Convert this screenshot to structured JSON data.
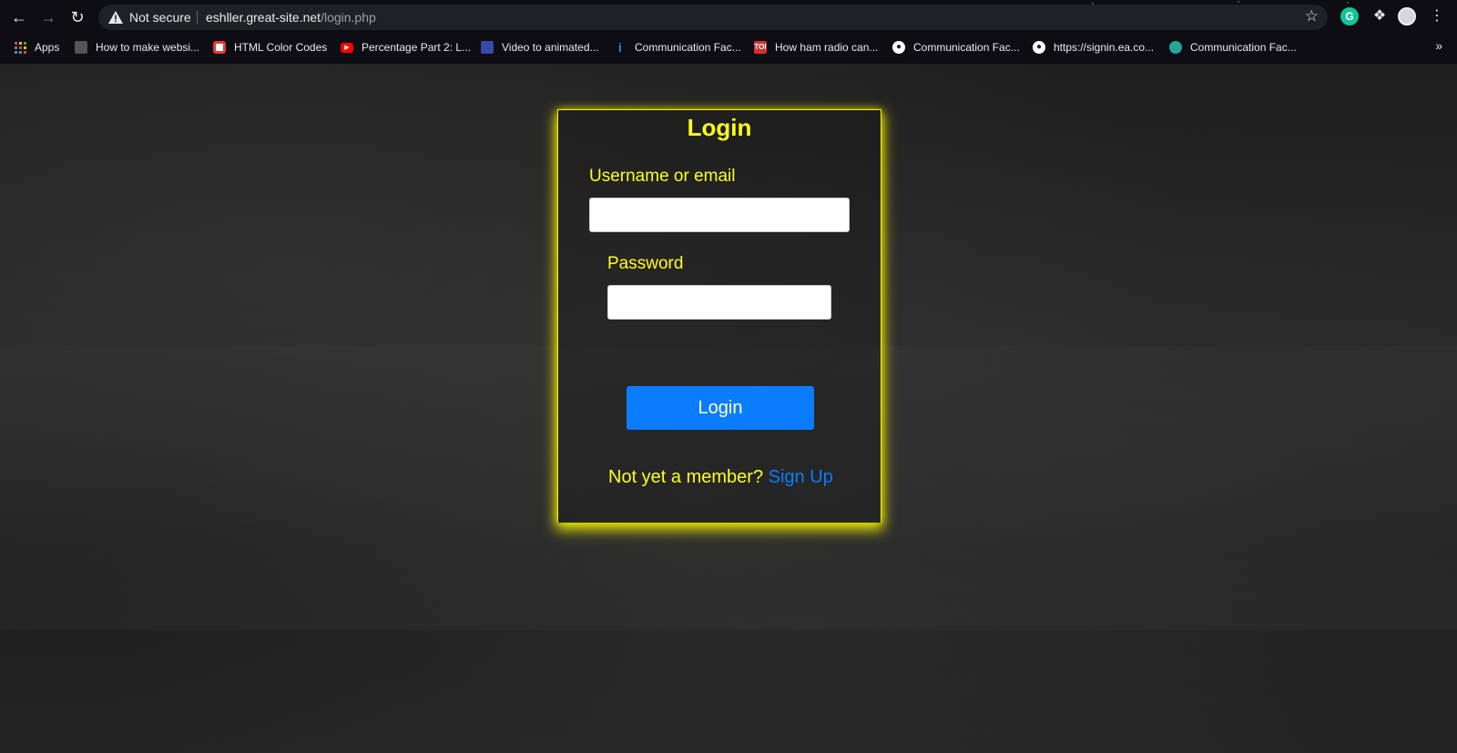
{
  "browser": {
    "status_text": "Not secure",
    "url_host": "eshller.great-site.net",
    "url_path": "/login.php",
    "bookmarks": [
      {
        "label": "Apps",
        "icon": "apps-grid-icon"
      },
      {
        "label": "How to make websi...",
        "icon": "site-favicon",
        "color": "#444"
      },
      {
        "label": "HTML Color Codes",
        "icon": "color-picker-favicon",
        "color": "#e53935"
      },
      {
        "label": "Percentage Part 2: L...",
        "icon": "youtube-icon",
        "color": "#ff0000"
      },
      {
        "label": "Video to animated...",
        "icon": "site-favicon",
        "color": "#3949ab"
      },
      {
        "label": "Communication Fac...",
        "icon": "info-favicon",
        "color": "#1e88e5"
      },
      {
        "label": "How ham radio can...",
        "icon": "toi-favicon",
        "color": "#d32f2f"
      },
      {
        "label": "Communication Fac...",
        "icon": "globe-icon",
        "color": "#ffffff"
      },
      {
        "label": "https://signin.ea.co...",
        "icon": "globe-icon",
        "color": "#ffffff"
      },
      {
        "label": "Communication Fac...",
        "icon": "sync-favicon",
        "color": "#26a69a"
      }
    ],
    "bookmarks_more": "»",
    "extension_letter": "G"
  },
  "login": {
    "title": "Login",
    "username_label": "Username or email",
    "username_value": "",
    "password_label": "Password",
    "password_value": "",
    "submit_label": "Login",
    "signup_prompt": "Not yet a member?",
    "signup_link": "Sign Up"
  },
  "colors": {
    "accent_yellow": "#ffff1a",
    "link_blue": "#0a7cff"
  }
}
